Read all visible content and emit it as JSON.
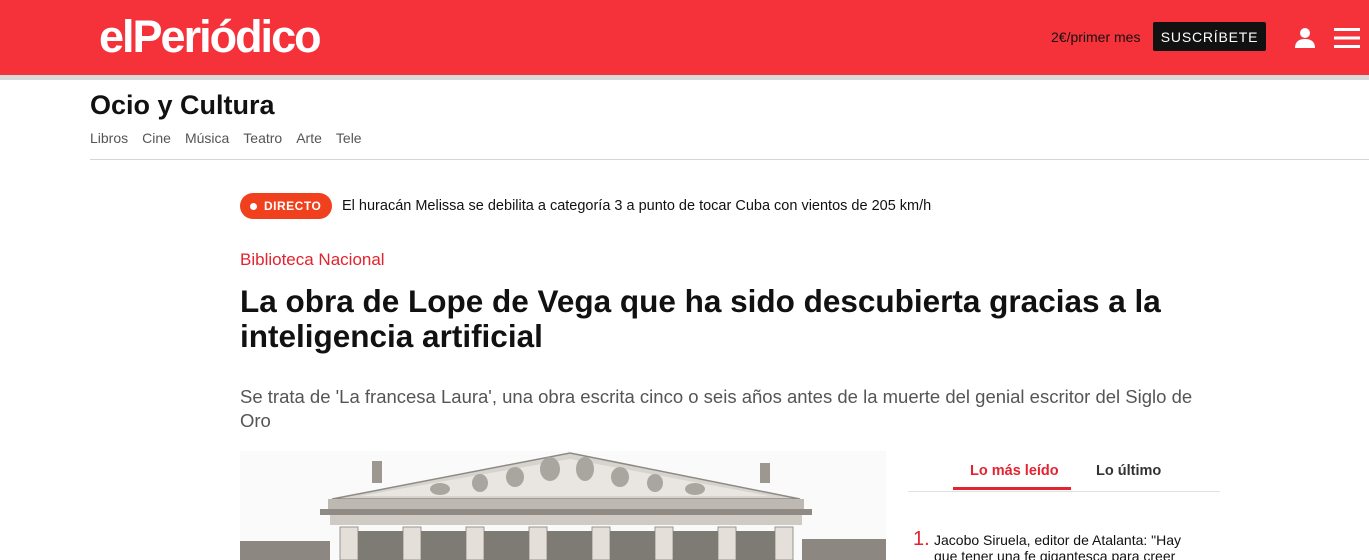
{
  "header": {
    "logo": "elPeriódico",
    "promo": "2€/primer mes",
    "subscribe_label": "SUSCRÍBETE",
    "brand_color": "#f5323a"
  },
  "section": {
    "title": "Ocio y Cultura",
    "nav": [
      "Libros",
      "Cine",
      "Música",
      "Teatro",
      "Arte",
      "Tele"
    ]
  },
  "live": {
    "badge": "DIRECTO",
    "text": "El huracán Melissa se debilita a categoría 3 a punto de tocar Cuba con vientos de 205 km/h"
  },
  "article": {
    "kicker": "Biblioteca Nacional",
    "headline": "La obra de Lope de Vega que ha sido descubierta gracias a la inteligencia artificial",
    "subhead": "Se trata de 'La francesa Laura', una obra escrita cinco o seis años antes de la muerte del genial escritor del Siglo de Oro"
  },
  "sidebar": {
    "tabs": [
      "Lo más leído",
      "Lo último"
    ],
    "items": [
      {
        "rank": "1.",
        "text": "Jacobo Siruela, editor de Atalanta: \"Hay que tener una fe gigantesca para creer"
      }
    ]
  },
  "icons": {
    "user": "user-icon",
    "menu": "hamburger-menu-icon"
  }
}
